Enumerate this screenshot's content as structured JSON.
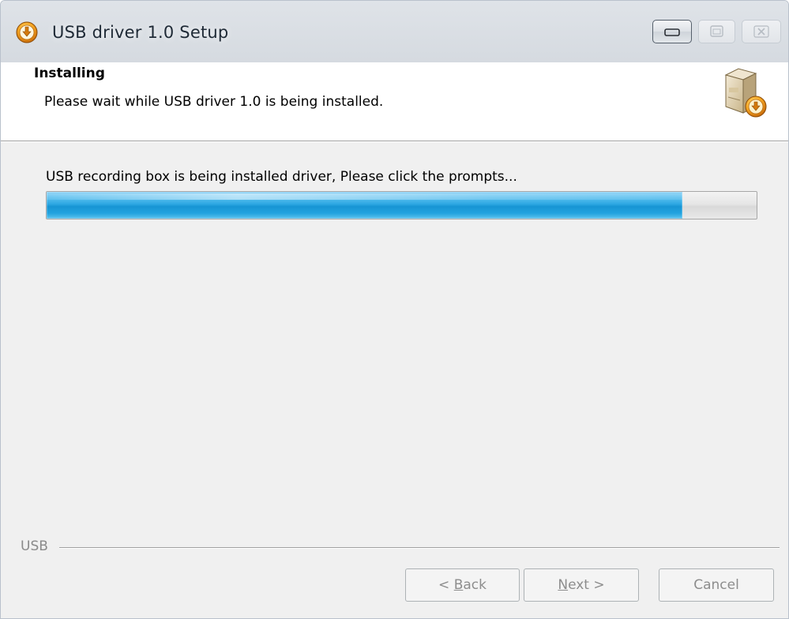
{
  "window": {
    "title": "USB driver 1.0 Setup",
    "icon": "installer-download-icon"
  },
  "header": {
    "title": "Installing",
    "subtitle": "Please wait while USB driver 1.0 is being installed.",
    "icon": "software-box-install-icon"
  },
  "content": {
    "status_text": "USB recording box is being installed driver, Please click the prompts...",
    "progress_fraction": 0.895
  },
  "footer": {
    "brand": "USB",
    "back_accel": "B",
    "back_rest": "ack",
    "back_prefix": "< ",
    "next_accel": "N",
    "next_rest": "ext >",
    "cancel_label": "Cancel"
  },
  "colors": {
    "progress_fill": "#1e9ed9",
    "header_bg": "#ffffff",
    "window_bg": "#f0f0f0",
    "disabled_text": "#8d8d8d"
  }
}
